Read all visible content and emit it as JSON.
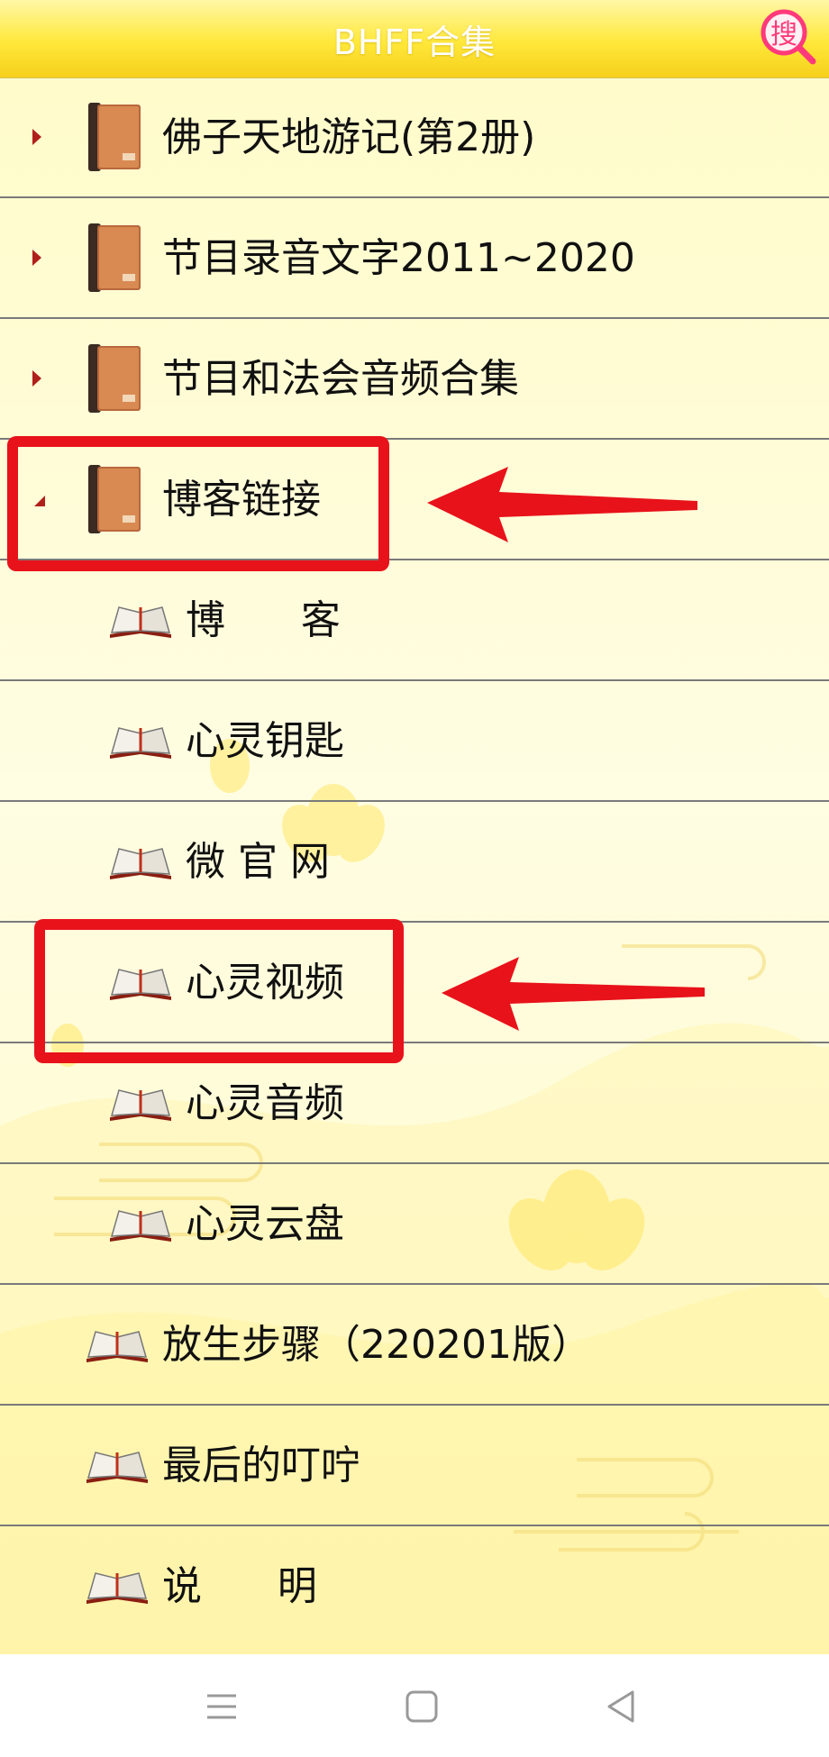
{
  "app": {
    "title": "BHFF合集"
  },
  "search_button": {
    "label": "搜",
    "color": "#ff3a7a"
  },
  "tree": {
    "items": [
      {
        "label": "佛子天地游记(第2册)",
        "type": "folder",
        "state": "collapsed"
      },
      {
        "label": "节目录音文字2011~2020",
        "type": "folder",
        "state": "collapsed"
      },
      {
        "label": "节目和法会音频合集",
        "type": "folder",
        "state": "collapsed"
      },
      {
        "label": "博客链接",
        "type": "folder",
        "state": "expanded",
        "highlighted": true
      },
      {
        "label": "博      客",
        "type": "child"
      },
      {
        "label": "心灵钥匙",
        "type": "child"
      },
      {
        "label": "微 官 网",
        "type": "child"
      },
      {
        "label": "心灵视频",
        "type": "child",
        "highlighted": true
      },
      {
        "label": "心灵音频",
        "type": "child"
      },
      {
        "label": "心灵云盘",
        "type": "child"
      },
      {
        "label": "放生步骤（220201版）",
        "type": "page"
      },
      {
        "label": "最后的叮咛",
        "type": "page"
      },
      {
        "label": "说      明",
        "type": "page"
      }
    ]
  },
  "navbar": {
    "icons": [
      "menu-icon",
      "home-square-icon",
      "back-triangle-icon"
    ]
  },
  "colors": {
    "highlight": "#e8121a",
    "title_bar": "#ffe83a",
    "expand_arrow": "#b0201a"
  }
}
